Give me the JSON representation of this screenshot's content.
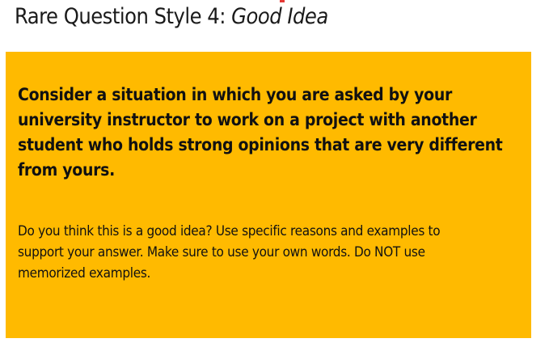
{
  "title": {
    "prefix": "Rare Question Style 4: ",
    "emphasis": "Good Idea"
  },
  "card": {
    "prompt": "Consider a situation in which you are asked by your university instructor to work on a project with another student who holds strong opinions that are very different from yours.",
    "instructions": "Do you think this is a good idea? Use specific reasons and examples to support your answer. Make sure to use your own words. Do NOT use memorized examples."
  },
  "colors": {
    "card_background": "#ffba00",
    "text": "#111111",
    "accent_mark": "#e53935"
  }
}
